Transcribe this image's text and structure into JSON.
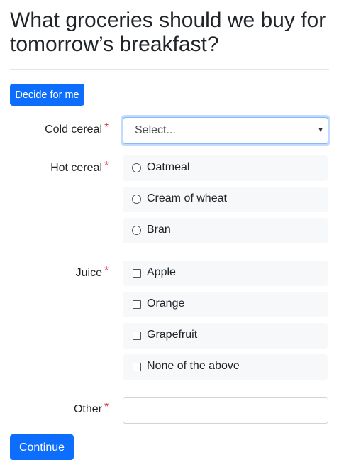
{
  "page": {
    "title": "What groceries should we buy for tomorrow’s breakfast?",
    "decide_label": "Decide for me",
    "continue_label": "Continue",
    "required_marker": "*"
  },
  "cold_cereal": {
    "label": "Cold cereal",
    "selected": "Select..."
  },
  "hot_cereal": {
    "label": "Hot cereal",
    "options": [
      "Oatmeal",
      "Cream of wheat",
      "Bran"
    ]
  },
  "juice": {
    "label": "Juice",
    "options": [
      "Apple",
      "Orange",
      "Grapefruit",
      "None of the above"
    ]
  },
  "other": {
    "label": "Other",
    "value": ""
  },
  "colors": {
    "primary": "#0d6efd",
    "required": "#dc3545"
  }
}
